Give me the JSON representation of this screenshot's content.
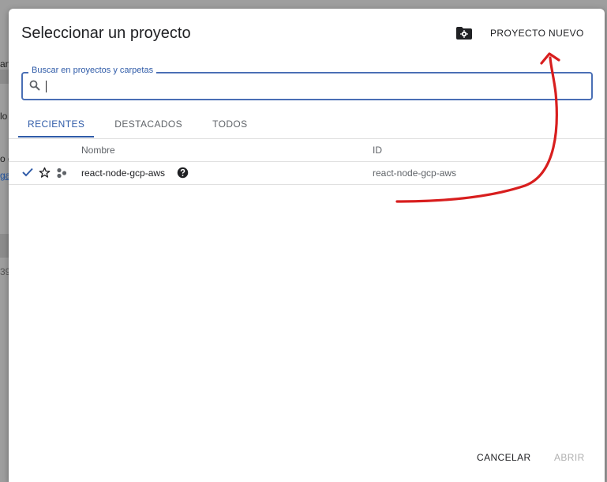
{
  "background": {
    "fragments": [
      "an",
      "lo",
      "o c",
      "ga",
      "39"
    ]
  },
  "dialog": {
    "title": "Seleccionar un proyecto",
    "new_project_label": "PROYECTO NUEVO",
    "new_project_icon": "folder-gear-icon"
  },
  "search": {
    "label": "Buscar en proyectos y carpetas",
    "value": "",
    "placeholder": ""
  },
  "tabs": [
    {
      "label": "RECIENTES",
      "active": true
    },
    {
      "label": "DESTACADOS",
      "active": false
    },
    {
      "label": "TODOS",
      "active": false
    }
  ],
  "table": {
    "headers": {
      "name": "Nombre",
      "id": "ID"
    },
    "rows": [
      {
        "name": "react-node-gcp-aws",
        "id": "react-node-gcp-aws",
        "selected": true,
        "starred": false
      }
    ]
  },
  "footer": {
    "cancel_label": "CANCELAR",
    "open_label": "ABRIR"
  },
  "colors": {
    "accent": "#2f5ba8",
    "annotation": "#d81e1e"
  }
}
